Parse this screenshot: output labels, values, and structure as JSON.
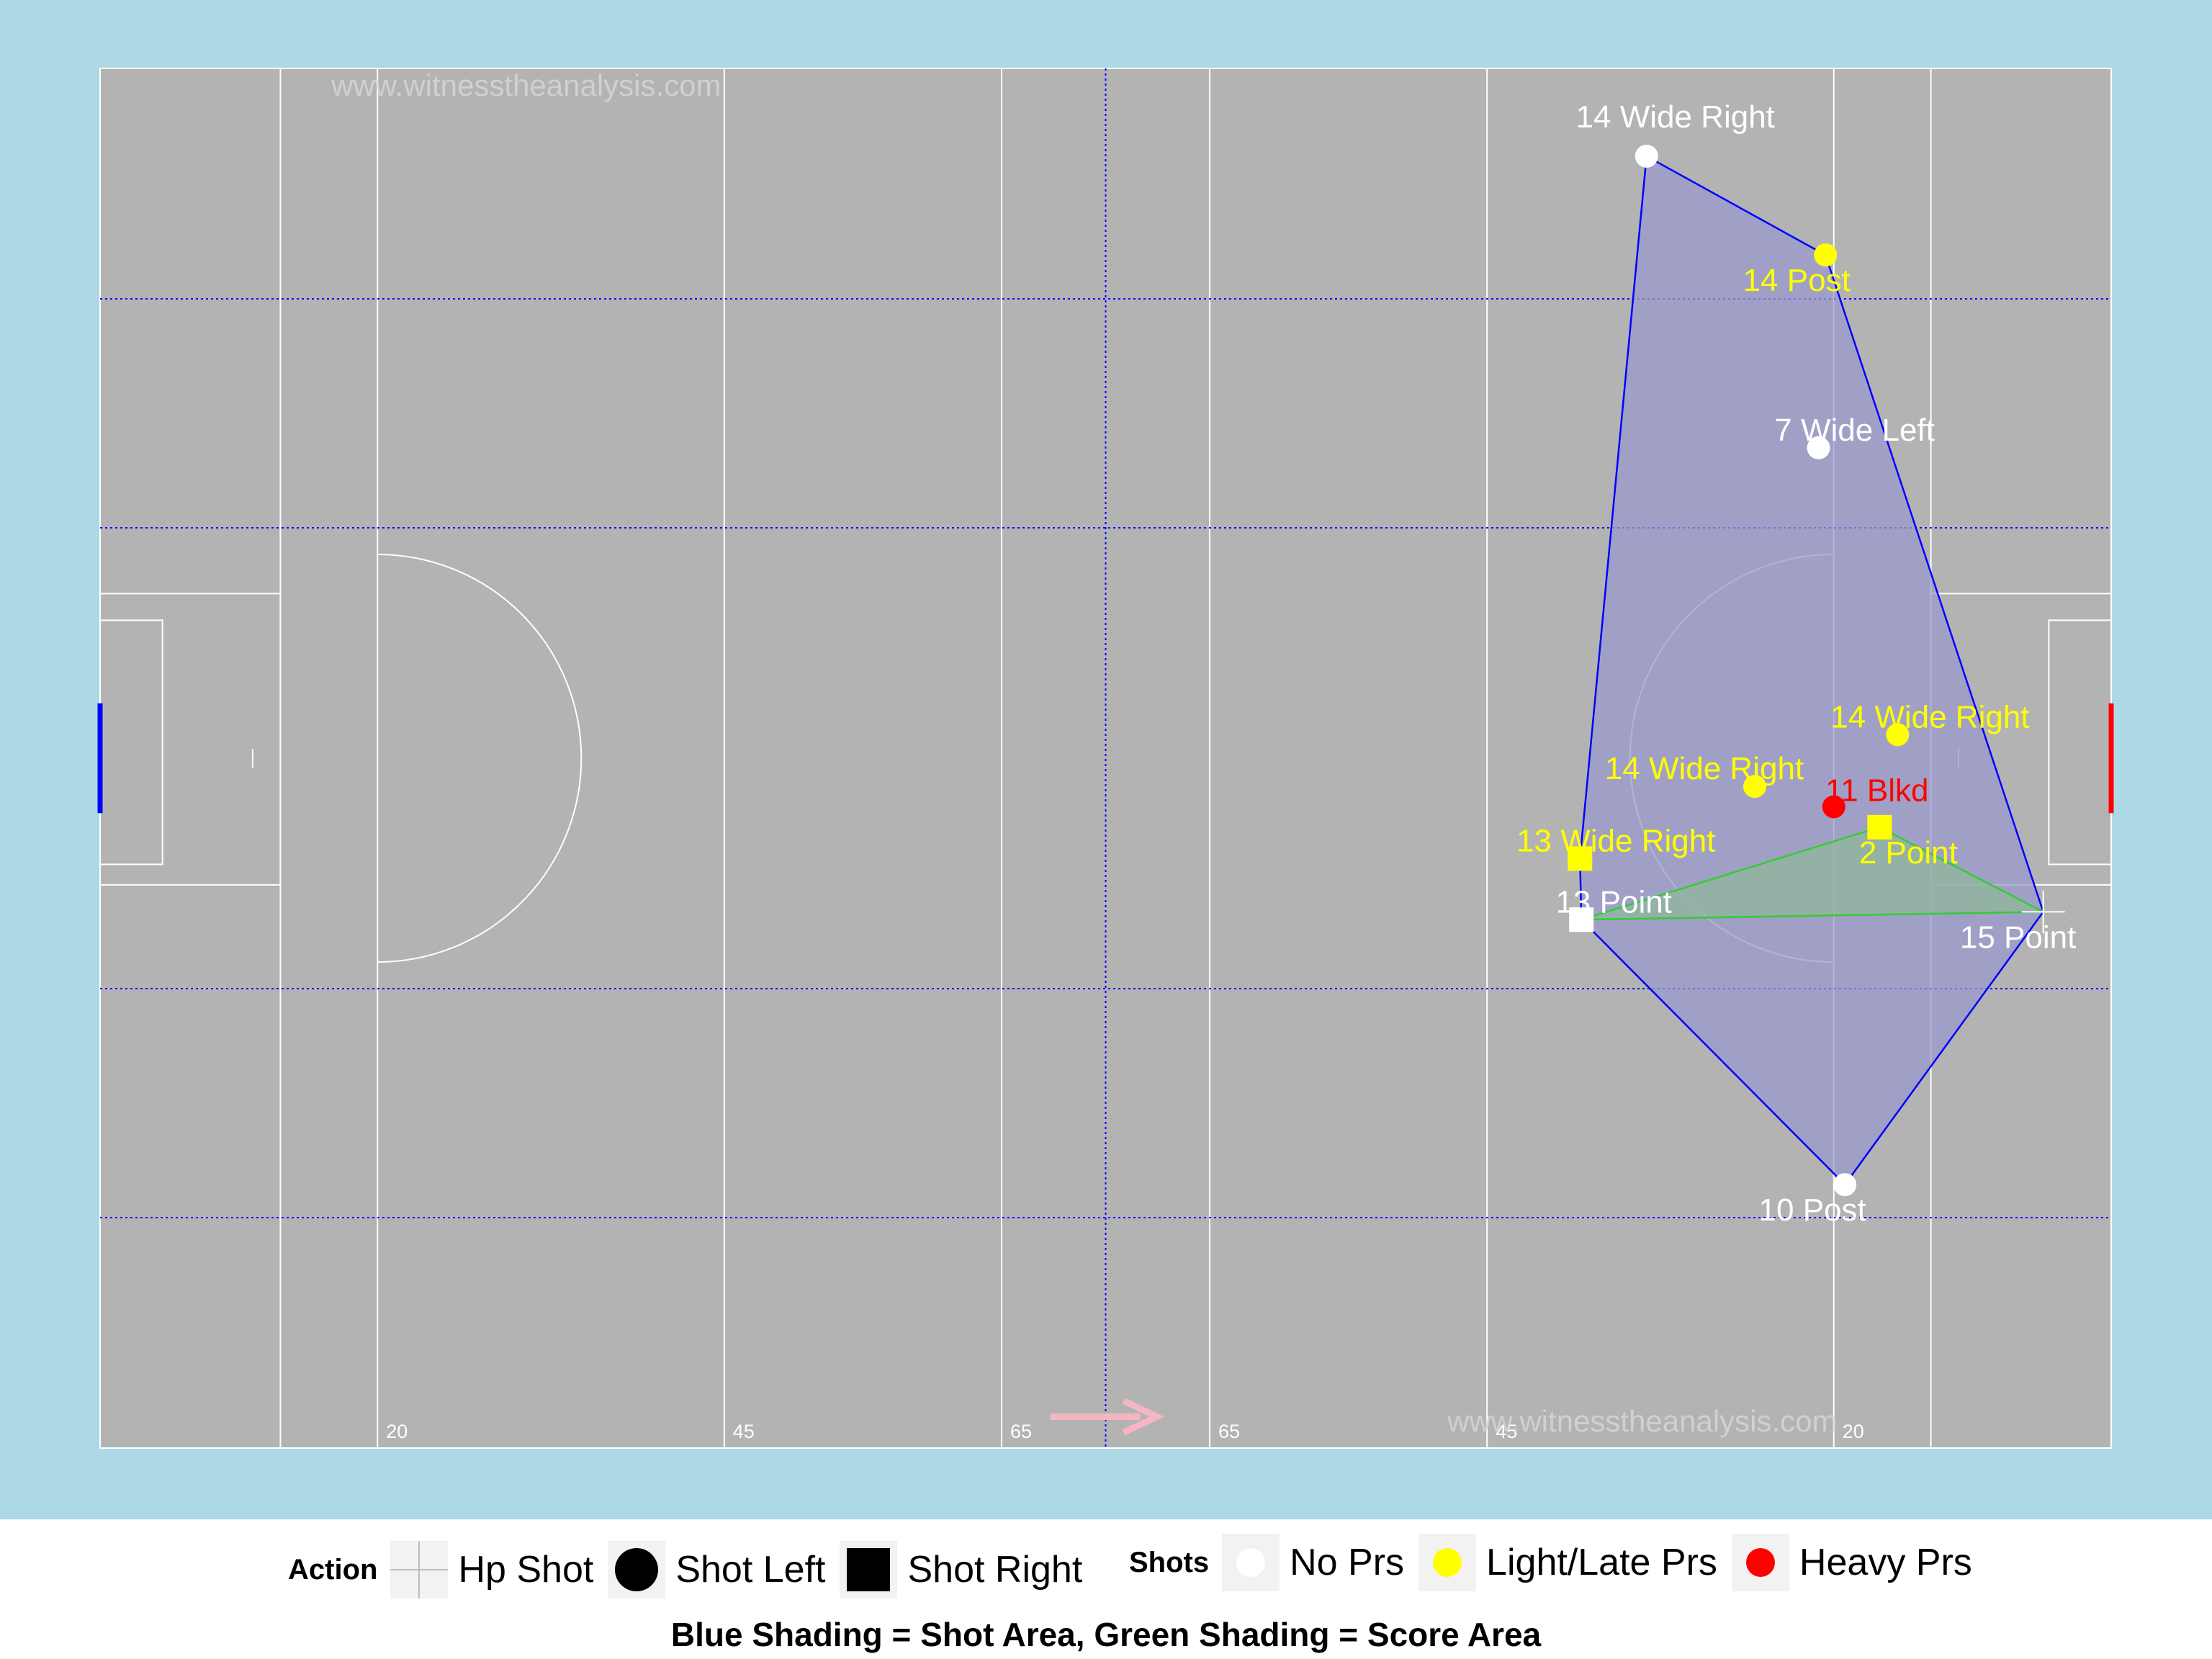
{
  "chart_data": {
    "type": "scatter",
    "title": "",
    "xlabel": "",
    "ylabel": "",
    "xlim": [
      0,
      145
    ],
    "ylim": [
      0,
      88
    ],
    "grid": true,
    "colors": {
      "background": "#add8e6",
      "pitch": "#b3b3b3",
      "pitch_lines": "#ffffff",
      "grid_lines": "#0000ff",
      "shot_area_fill": "#9999cc",
      "shot_area_stroke": "#0000ff",
      "score_area_fill": "#8fb89a",
      "score_area_stroke": "#33cc33",
      "no_prs": "#ffffff",
      "light_prs": "#ffff00",
      "heavy_prs": "#ff0000",
      "left_goal": "#0000ff",
      "right_goal": "#ff0000",
      "direction_arrow": "#f4b6c2"
    },
    "yard_labels": [
      "20",
      "45",
      "65",
      "65",
      "45",
      "20"
    ],
    "watermarks": [
      "www.witnesstheanalysis.com",
      "www.witnesstheanalysis.com"
    ],
    "shots": [
      {
        "label": "14 Wide Right",
        "x": 111.5,
        "y": 82.4,
        "pressure": "No Prs",
        "shape": "circle"
      },
      {
        "label": "14 Post",
        "x": 124.4,
        "y": 76.1,
        "pressure": "Light/Late Prs",
        "shape": "circle"
      },
      {
        "label": "7 Wide Left",
        "x": 123.9,
        "y": 63.8,
        "pressure": "No Prs",
        "shape": "circle"
      },
      {
        "label": "14 Wide Right",
        "x": 129.6,
        "y": 45.5,
        "pressure": "Light/Late Prs",
        "shape": "circle"
      },
      {
        "label": "14 Wide Right",
        "x": 119.3,
        "y": 42.2,
        "pressure": "Light/Late Prs",
        "shape": "circle"
      },
      {
        "label": "11 Blkd",
        "x": 125.0,
        "y": 40.9,
        "pressure": "Heavy Prs",
        "shape": "circle"
      },
      {
        "label": "2 Point",
        "x": 128.3,
        "y": 39.6,
        "pressure": "Light/Late Prs",
        "shape": "square"
      },
      {
        "label": "13 Wide Right",
        "x": 106.7,
        "y": 37.6,
        "pressure": "Light/Late Prs",
        "shape": "square"
      },
      {
        "label": "13 Point",
        "x": 106.8,
        "y": 33.7,
        "pressure": "No Prs",
        "shape": "square"
      },
      {
        "label": "15 Point",
        "x": 140.1,
        "y": 34.2,
        "pressure": "No Prs",
        "shape": "cross"
      },
      {
        "label": "10 Post",
        "x": 125.8,
        "y": 16.8,
        "pressure": "No Prs",
        "shape": "circle"
      }
    ],
    "shot_area": [
      [
        111.5,
        82.4
      ],
      [
        124.4,
        76.1
      ],
      [
        140.1,
        34.2
      ],
      [
        125.8,
        16.8
      ],
      [
        106.8,
        33.7
      ],
      [
        106.7,
        37.6
      ]
    ],
    "score_area": [
      [
        106.8,
        33.7
      ],
      [
        128.3,
        39.6
      ],
      [
        140.1,
        34.2
      ]
    ]
  },
  "legend": {
    "action_title": "Action",
    "action_items": [
      "Hp Shot",
      "Shot Left",
      "Shot Right"
    ],
    "shots_title": "Shots",
    "shots_items": [
      "No Prs",
      "Light/Late Prs",
      "Heavy Prs"
    ],
    "caption": "Blue Shading = Shot Area, Green Shading = Score Area"
  }
}
